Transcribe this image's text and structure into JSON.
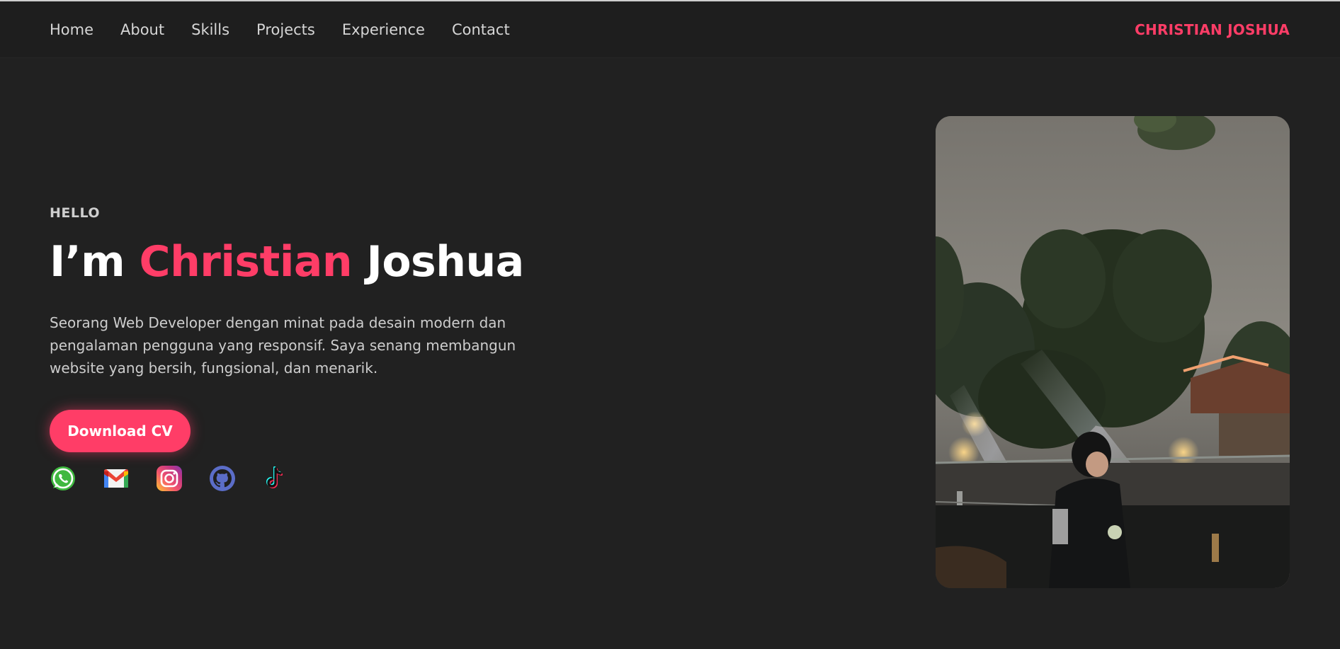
{
  "nav": {
    "links": [
      "Home",
      "About",
      "Skills",
      "Projects",
      "Experience",
      "Contact"
    ],
    "brand": "CHRISTIAN JOSHUA"
  },
  "hero": {
    "greeting": "HELLO",
    "headline_prefix": "I’m",
    "headline_highlight": "Christian",
    "headline_suffix": "Joshua",
    "description": "Seorang Web Developer dengan minat pada desain modern dan pengalaman pengguna yang responsif. Saya senang membangun website yang bersih, fungsional, dan menarik.",
    "cta_label": "Download CV"
  },
  "socials": [
    {
      "icon": "whatsapp-icon"
    },
    {
      "icon": "gmail-icon"
    },
    {
      "icon": "instagram-icon"
    },
    {
      "icon": "github-icon"
    },
    {
      "icon": "tiktok-icon"
    }
  ],
  "photo": {
    "icon": "profile-photo"
  },
  "colors": {
    "background": "#212121",
    "navbar": "#1e1e1e",
    "accent": "#ff3d67",
    "text": "#ffffff",
    "muted_text": "#cdcdcd"
  }
}
